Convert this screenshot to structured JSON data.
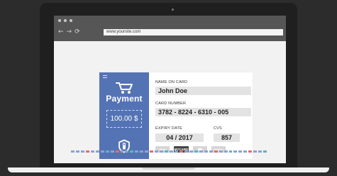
{
  "browser": {
    "url": "www.yoursite.com"
  },
  "payment_panel": {
    "title": "Payment",
    "amount": "100.00 $"
  },
  "form": {
    "name_label": "NAME ON CARD",
    "name_value": "John Doe",
    "card_label": "CARD NUMBER",
    "card_value": "3782 - 8224 - 6310 - 005",
    "expiry_label": "EXPIRY DATE",
    "expiry_value": "04 / 2017",
    "cvs_label": "CVS",
    "cvs_value": "857"
  },
  "payment_methods": [
    {
      "label": "VISA"
    },
    {
      "label": "MYCARD"
    },
    {
      "label": ""
    },
    {
      "label": "PayPal"
    }
  ],
  "icons": {
    "back": "arrow-left-icon",
    "forward": "arrow-right-icon",
    "refresh": "refresh-icon",
    "cart": "shopping-cart-icon",
    "shield": "shield-icon",
    "menu": "menu-icon",
    "camera": "camera-icon"
  },
  "colors": {
    "panel": "#5473B4",
    "page": "#F2F2F2",
    "accent": "#E86B6B",
    "accent2": "#57B7C0"
  },
  "stripe_colors": [
    "#8aa3d6",
    "#8aa3d6",
    "#8aa3d6",
    "#e86b6b",
    "#8aa3d6",
    "#8aa3d6",
    "#8aa3d6",
    "#57b7c0",
    "#8aa3d6",
    "#e86b6b",
    "#8aa3d6",
    "#8aa3d6",
    "#57b7c0",
    "#8aa3d6",
    "#8aa3d6",
    "#8aa3d6",
    "#e86b6b",
    "#8aa3d6",
    "#8aa3d6",
    "#57b7c0",
    "#8aa3d6",
    "#8aa3d6",
    "#e86b6b",
    "#8aa3d6",
    "#8aa3d6",
    "#57b7c0",
    "#8aa3d6",
    "#8aa3d6",
    "#8aa3d6",
    "#e86b6b",
    "#8aa3d6",
    "#8aa3d6",
    "#57b7c0",
    "#8aa3d6",
    "#8aa3d6",
    "#8aa3d6",
    "#e86b6b",
    "#8aa3d6",
    "#8aa3d6",
    "#57b7c0"
  ]
}
